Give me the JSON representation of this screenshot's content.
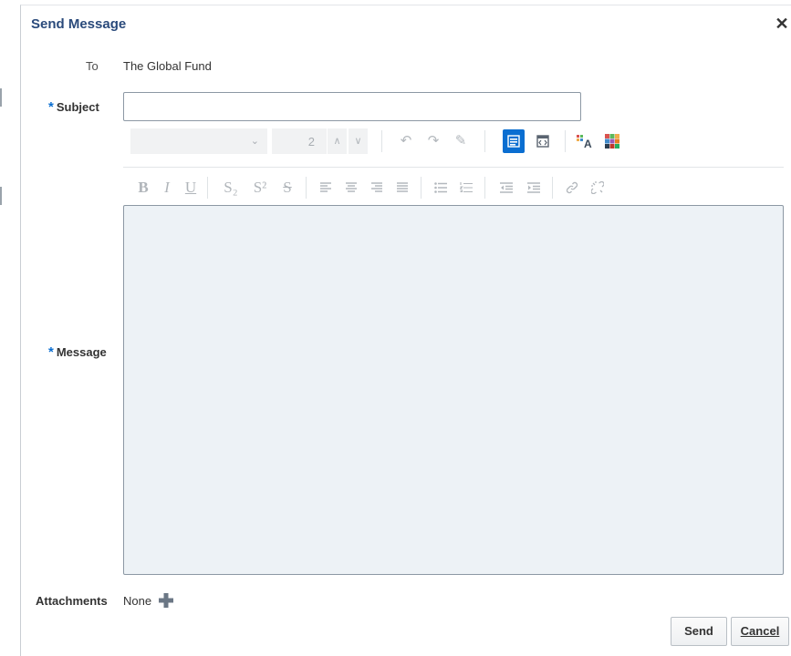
{
  "dialog": {
    "title": "Send Message",
    "close_icon": "close-icon"
  },
  "form": {
    "to_label": "To",
    "to_value": "The Global Fund",
    "required_marker": "*",
    "subject_label": "Subject",
    "subject_value": "",
    "message_label": "Message",
    "message_value": "",
    "attachments_label": "Attachments",
    "attachments_value": "None"
  },
  "toolbar": {
    "font_size_value": "2",
    "row1_icons": [
      "font-family-select",
      "font-size-select",
      "undo-icon",
      "redo-icon",
      "clear-format-icon",
      "rich-text-mode-icon",
      "source-mode-icon",
      "text-color-icon",
      "background-color-icon"
    ],
    "row2": {
      "bold": "B",
      "italic": "I",
      "underline": "U",
      "subscript": "S₂",
      "superscript": "S²",
      "strikethrough": "S"
    }
  },
  "buttons": {
    "send_label": "Send",
    "cancel_label": "Cancel"
  },
  "colors": {
    "accent": "#0a6ed1",
    "title": "#2a4a7b",
    "message_bg": "#edf2f6"
  }
}
